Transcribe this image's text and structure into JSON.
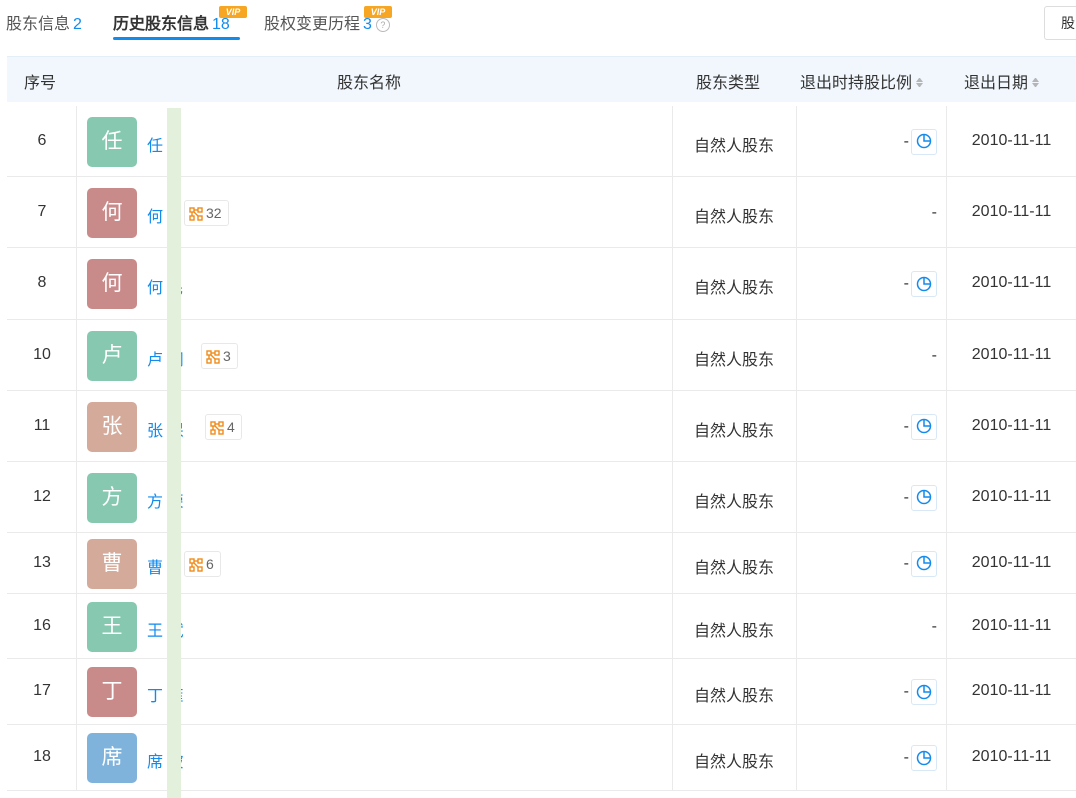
{
  "tabs": [
    {
      "label": "股东信息",
      "count": "2"
    },
    {
      "label": "历史股东信息",
      "count": "18",
      "vip": "VIP"
    },
    {
      "label": "股权变更历程",
      "count": "3",
      "vip": "VIP",
      "help": "?"
    }
  ],
  "right_button": "股",
  "table": {
    "headers": {
      "seq": "序号",
      "name": "股东名称",
      "type": "股东类型",
      "ratio": "退出时持股比例",
      "date": "退出日期"
    },
    "rows": [
      {
        "seq": "6",
        "avatar": "任",
        "avatar_color": "#86c9b0",
        "name": "任",
        "badge": "",
        "type": "自然人股东",
        "ratio": "-",
        "pie": true,
        "date": "2010-11-11"
      },
      {
        "seq": "7",
        "avatar": "何",
        "avatar_color": "#c98a8a",
        "name": "何",
        "badge": "32",
        "type": "自然人股东",
        "ratio": "-",
        "pie": false,
        "date": "2010-11-11"
      },
      {
        "seq": "8",
        "avatar": "何",
        "avatar_color": "#c98a8a",
        "name": "何 民",
        "badge": "",
        "type": "自然人股东",
        "ratio": "-",
        "pie": true,
        "date": "2010-11-11"
      },
      {
        "seq": "10",
        "avatar": "卢",
        "avatar_color": "#86c9b0",
        "name": "卢 钢",
        "badge": "3",
        "type": "自然人股东",
        "ratio": "-",
        "pie": false,
        "date": "2010-11-11"
      },
      {
        "seq": "11",
        "avatar": "张",
        "avatar_color": "#d4aa9a",
        "name": "张 保",
        "badge": "4",
        "type": "自然人股东",
        "ratio": "-",
        "pie": true,
        "date": "2010-11-11"
      },
      {
        "seq": "12",
        "avatar": "方",
        "avatar_color": "#86c9b0",
        "name": "方 荣",
        "badge": "",
        "type": "自然人股东",
        "ratio": "-",
        "pie": true,
        "date": "2010-11-11"
      },
      {
        "seq": "13",
        "avatar": "曹",
        "avatar_color": "#d4aa9a",
        "name": "曹",
        "badge": "6",
        "type": "自然人股东",
        "ratio": "-",
        "pie": true,
        "date": "2010-11-11"
      },
      {
        "seq": "16",
        "avatar": "王",
        "avatar_color": "#86c9b0",
        "name": "王 斌",
        "badge": "",
        "type": "自然人股东",
        "ratio": "-",
        "pie": false,
        "date": "2010-11-11"
      },
      {
        "seq": "17",
        "avatar": "丁",
        "avatar_color": "#c98a8a",
        "name": "丁 雍",
        "badge": "",
        "type": "自然人股东",
        "ratio": "-",
        "pie": true,
        "date": "2010-11-11"
      },
      {
        "seq": "18",
        "avatar": "席",
        "avatar_color": "#7fb3dc",
        "name": "席 坡",
        "badge": "",
        "type": "自然人股东",
        "ratio": "-",
        "pie": true,
        "date": "2010-11-11"
      }
    ]
  },
  "icons": {
    "badge_icon": "relation-network-icon",
    "pie_icon": "pie-chart-icon"
  },
  "colors": {
    "accent": "#128bed",
    "vip": "#f6a623",
    "header_bg": "#f1f7fd"
  }
}
